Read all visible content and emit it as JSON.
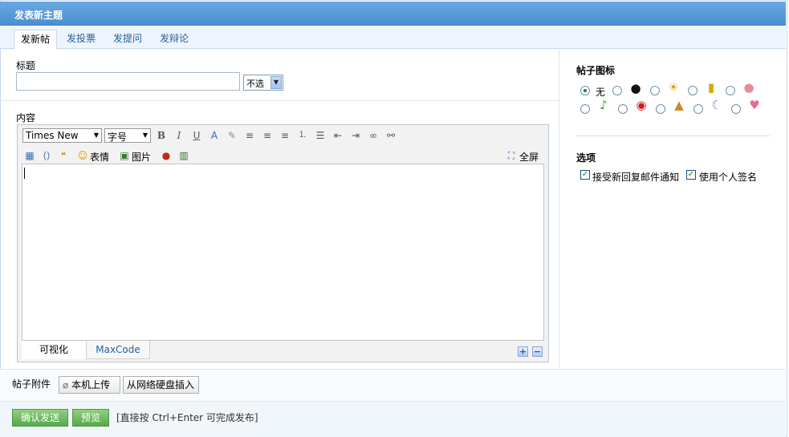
{
  "window": {
    "title": "发表新主题"
  },
  "tabs": [
    "发新帖",
    "发投票",
    "发提问",
    "发辩论"
  ],
  "subject": {
    "label": "标题",
    "value": "",
    "select_value": "不选"
  },
  "content": {
    "label": "内容"
  },
  "editor": {
    "font": "Times New",
    "size": "字号",
    "emoticon_label": "表情",
    "image_label": "图片",
    "fullscreen_label": "全屏",
    "mode_tabs": [
      "可视化",
      "MaxCode"
    ],
    "body": ""
  },
  "sidebar": {
    "icon_heading": "帖子图标",
    "none_label": "无",
    "options_heading": "选项",
    "option1": "接受新回复邮件通知",
    "option2": "使用个人签名"
  },
  "attachments": {
    "label": "帖子附件",
    "local_upload": "本机上传",
    "disk_insert": "从网络硬盘插入"
  },
  "actions": {
    "submit": "确认发送",
    "preview": "预览",
    "hint": "[直接按 Ctrl+Enter 可完成发布]"
  },
  "colors": {
    "title_bar": "#4a8fd2",
    "accent_text": "#1f5f9e",
    "green_button": "#57a84a"
  }
}
